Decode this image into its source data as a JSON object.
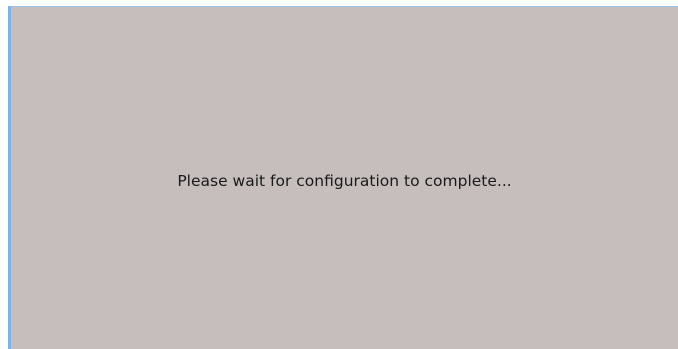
{
  "dialog": {
    "message": "Please wait for configuration to complete..."
  },
  "colors": {
    "panel_background": "#c5bebd",
    "window_border_accent": "#7fb1e6",
    "text": "#1a1a1a"
  }
}
